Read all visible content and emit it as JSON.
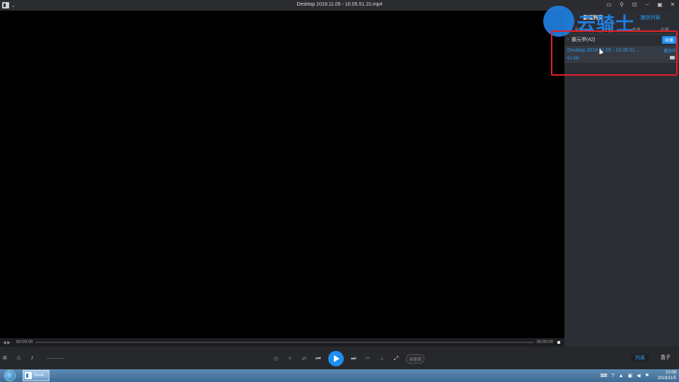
{
  "window": {
    "title": "Desktop 2019.11.05 - 10.05.51.10.mp4",
    "caret": "⌄"
  },
  "window_controls": [
    "▭",
    "⚲",
    "⊡",
    "–",
    "▣",
    "✕"
  ],
  "panel": {
    "tab_active": "影视列表",
    "tab_inactive": "播放列表",
    "sub_tabs": [
      "全部",
      "已观",
      "本地",
      "云盘"
    ],
    "group_label": "霸元甲(42)",
    "continue_label": "续播",
    "file": {
      "name": "Desktop 2019.11.05 - 10.05.51....",
      "status": "播放中",
      "size": "62.4M"
    }
  },
  "watermark": {
    "text": "云骑士"
  },
  "progress": {
    "nav": "◀ ▶",
    "time_current": "00:00:00",
    "time_total": "00:00:00",
    "played_fraction": 0
  },
  "controls": {
    "left_icons": [
      "toolbox-icon",
      "folder-open-icon",
      "mute-icon"
    ],
    "speed_label": "调速度",
    "right_list": "列表",
    "right_box": "盒子"
  },
  "taskbar": {
    "app_label": "Desk...",
    "clock_time": "10:08",
    "clock_date": "2019/11/5"
  },
  "colors": {
    "accent": "#1e8ef0",
    "highlight": "#e0202a",
    "panel_bg": "#2b2e34"
  }
}
